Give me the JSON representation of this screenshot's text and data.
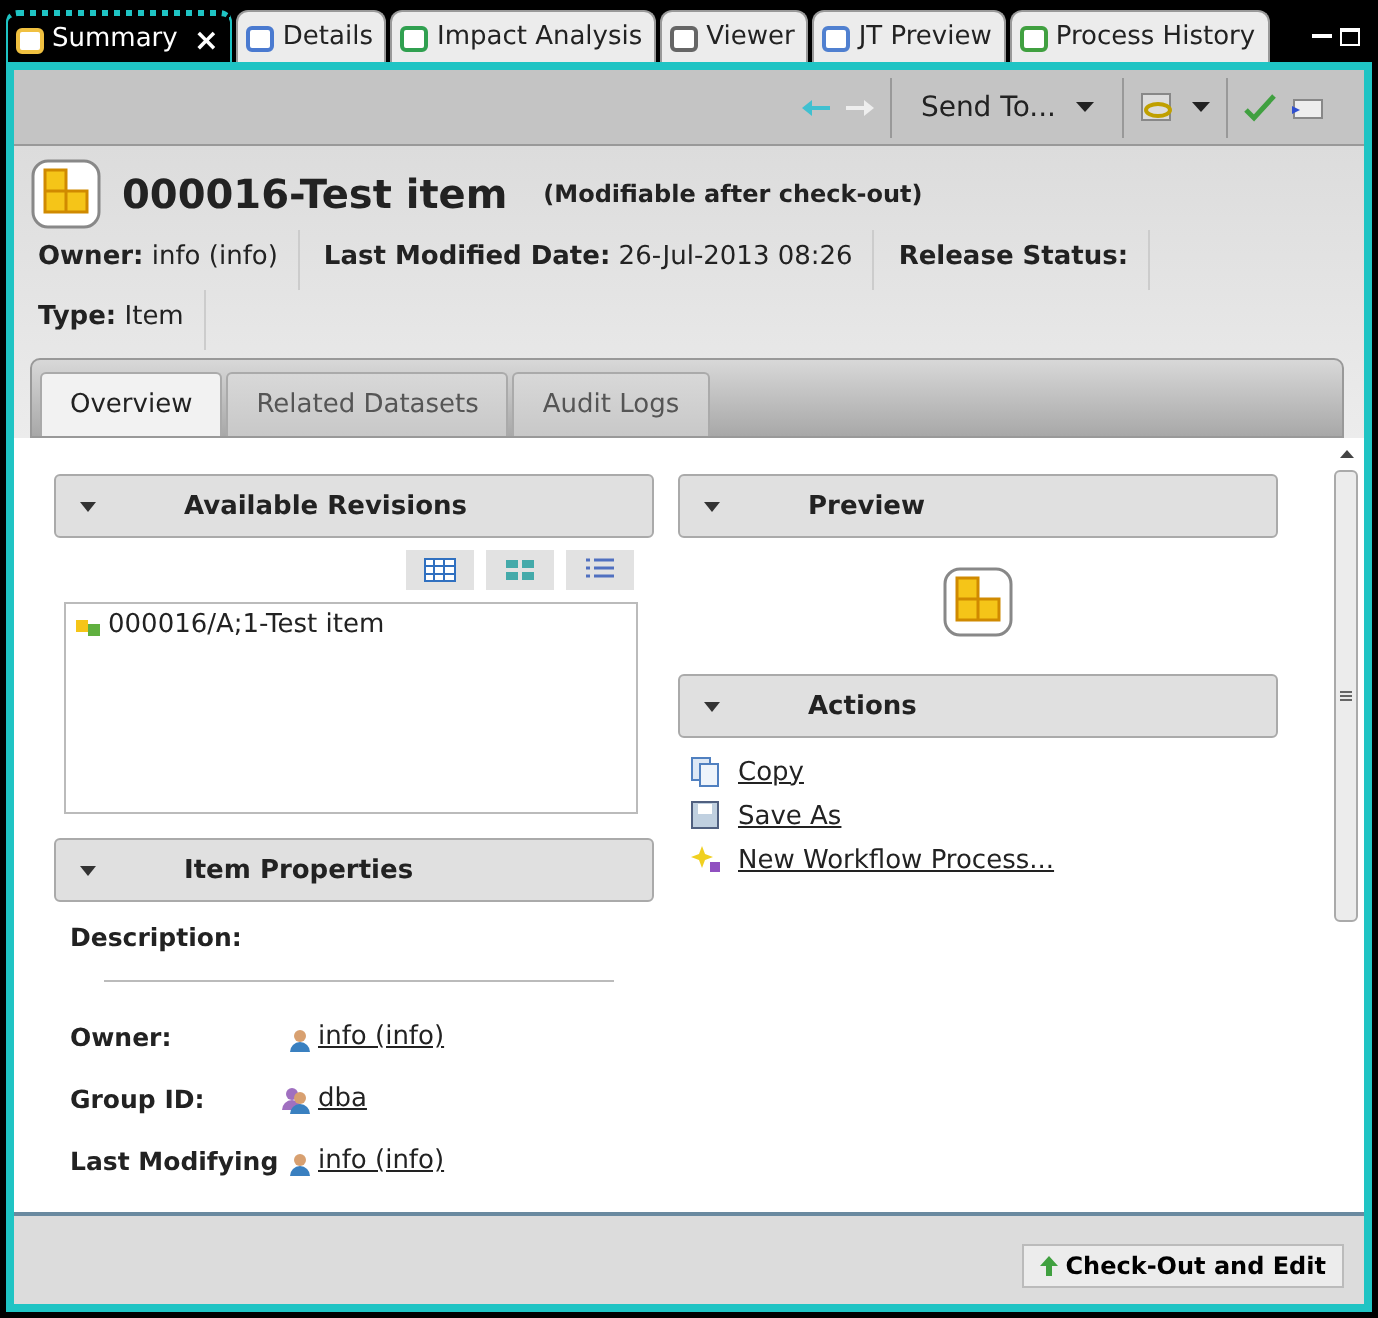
{
  "editor_tabs": [
    {
      "label": "Summary",
      "selected": true,
      "close": "×",
      "kind": "summary"
    },
    {
      "label": "Details",
      "selected": false,
      "kind": "details"
    },
    {
      "label": "Impact Analysis",
      "selected": false,
      "kind": "impact"
    },
    {
      "label": "Viewer",
      "selected": false,
      "kind": "viewer"
    },
    {
      "label": "JT Preview",
      "selected": false,
      "kind": "jt"
    },
    {
      "label": "Process History",
      "selected": false,
      "kind": "history"
    }
  ],
  "toolbar": {
    "send_to": "Send To..."
  },
  "header": {
    "title": "000016-Test item",
    "note": "(Modifiable after check-out)",
    "fields": [
      {
        "label": "Owner:",
        "value": "info (info)"
      },
      {
        "label": "Last Modified Date:",
        "value": "26-Jul-2013 08:26"
      },
      {
        "label": "Release Status:"
      },
      {
        "label": "Type:",
        "value": "Item"
      }
    ]
  },
  "view_tabs": [
    {
      "label": "Overview",
      "selected": true
    },
    {
      "label": "Related Datasets",
      "selected": false
    },
    {
      "label": "Audit Logs",
      "selected": false
    }
  ],
  "revisions": {
    "title": "Available Revisions",
    "items": [
      "000016/A;1-Test item"
    ]
  },
  "properties": {
    "title": "Item Properties",
    "description_label": "Description:",
    "rows": [
      {
        "label": "Owner:",
        "value": "info (info)",
        "kind": "user"
      },
      {
        "label": "Group ID:",
        "value": "dba",
        "kind": "group"
      },
      {
        "label": "Last Modifying",
        "value": "info (info)",
        "kind": "user"
      }
    ]
  },
  "preview": {
    "title": "Preview"
  },
  "actions": {
    "title": "Actions",
    "items": [
      {
        "label": "Copy",
        "kind": "copy"
      },
      {
        "label": "Save As",
        "kind": "save"
      },
      {
        "label": "New Workflow Process...",
        "kind": "workflow"
      }
    ]
  },
  "footer": {
    "button": "Check-Out and Edit"
  }
}
